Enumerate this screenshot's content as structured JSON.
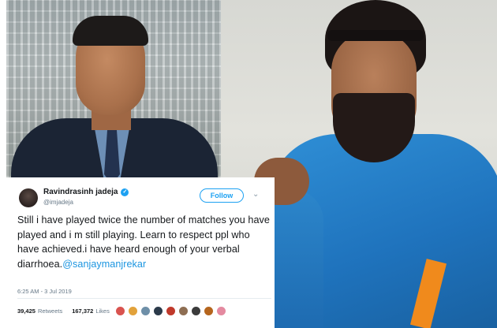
{
  "tweet": {
    "display_name": "Ravindrasinh jadeja",
    "verified_mark": "✓",
    "handle": "@imjadeja",
    "follow_label": "Follow",
    "more_icon": "chevron-down-icon",
    "chevron_glyph": "⌄",
    "text_main": "Still i have played twice the number of matches you have played and i m still playing. Learn to respect ppl who have achieved.i have heard enough of your verbal diarrhoea.",
    "mention": "@sanjaymanjrekar",
    "timestamp": "6:25 AM - 3 Jul 2019",
    "retweets_count": "39,425",
    "retweets_label": "Retweets",
    "likes_count": "167,372",
    "likes_label": "Likes",
    "liker_colors": [
      "#d9534f",
      "#e2a23b",
      "#6e8fa8",
      "#2b3a4a",
      "#c0392b",
      "#8e6e53",
      "#3b3b3b",
      "#b5651d",
      "#e48aa0"
    ]
  },
  "colors": {
    "twitter_blue": "#1da1f2",
    "mention_blue": "#1b95e0",
    "text_dark": "#14171a",
    "text_muted": "#657786"
  }
}
